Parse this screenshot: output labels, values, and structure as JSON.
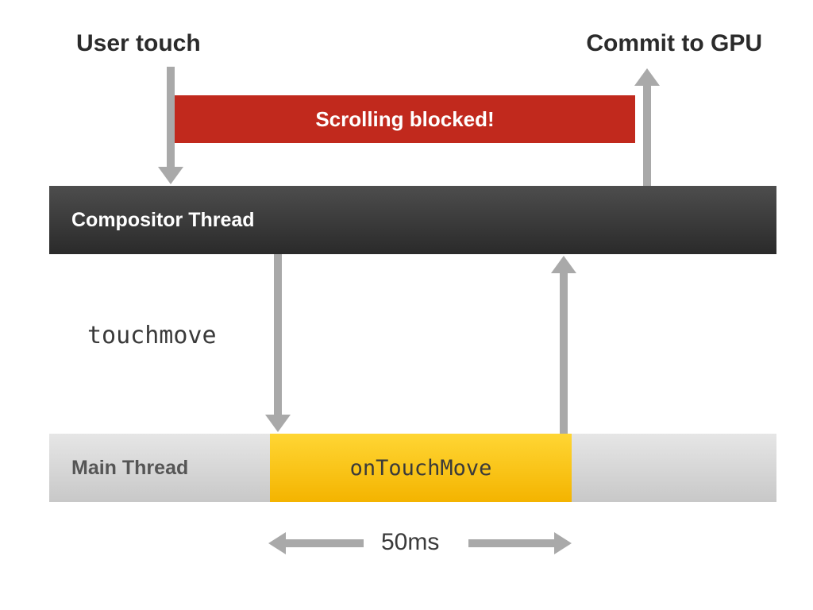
{
  "labels": {
    "user_touch": "User touch",
    "commit_to_gpu": "Commit to GPU",
    "scrolling_blocked": "Scrolling blocked!",
    "compositor_thread": "Compositor Thread",
    "main_thread": "Main Thread",
    "touchmove": "touchmove",
    "on_touch_move": "onTouchMove",
    "duration": "50ms"
  },
  "colors": {
    "blocked_bg": "#c1291d",
    "compositor_bg_top": "#4d4d4d",
    "compositor_bg_bottom": "#2a2a2a",
    "mainthread_bg_top": "#e6e6e6",
    "mainthread_bg_bottom": "#c8c8c8",
    "ontouch_bg_top": "#ffd634",
    "ontouch_bg_bottom": "#f4b400",
    "arrow": "#a9a9a9"
  },
  "chart_data": {
    "type": "diagram",
    "title": "Touch event flow through compositor and main threads",
    "threads": [
      "Compositor Thread",
      "Main Thread"
    ],
    "events_on_compositor": [
      "User touch (in)",
      "Commit to GPU (out)"
    ],
    "main_thread_handler": "onTouchMove",
    "main_thread_handler_duration_ms": 50,
    "message_compositor_to_main": "touchmove",
    "blocked_span": "Scrolling blocked! (from user-touch arrow to commit-to-GPU arrow)",
    "arrows": [
      {
        "from": "User touch label",
        "to": "Compositor Thread",
        "dir": "down"
      },
      {
        "from": "Compositor Thread",
        "to": "Commit to GPU label",
        "dir": "up"
      },
      {
        "from": "Compositor Thread",
        "to": "Main Thread onTouchMove start",
        "dir": "down",
        "label": "touchmove"
      },
      {
        "from": "Main Thread onTouchMove end",
        "to": "Compositor Thread",
        "dir": "up"
      }
    ]
  }
}
